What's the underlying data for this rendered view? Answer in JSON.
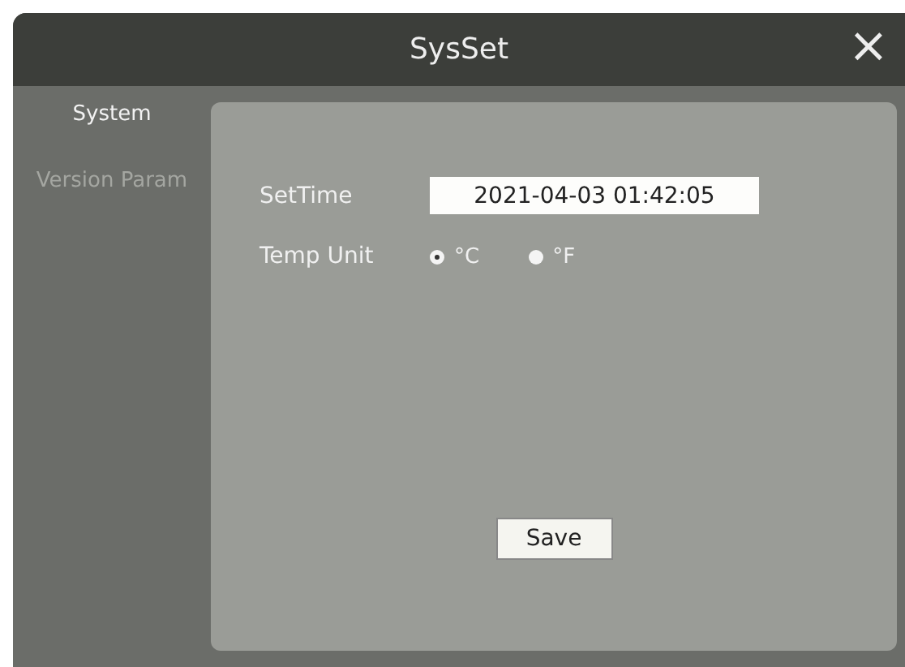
{
  "window": {
    "title": "SysSet",
    "close": "×"
  },
  "sidebar": {
    "items": [
      {
        "label": "System",
        "selected": true
      },
      {
        "label": "Version Param",
        "selected": false
      }
    ]
  },
  "form": {
    "set_time": {
      "label": "SetTime",
      "value": "2021-04-03 01:42:05"
    },
    "temp_unit": {
      "label": "Temp Unit",
      "options": [
        {
          "label": "°C",
          "selected": true
        },
        {
          "label": "°F",
          "selected": false
        }
      ]
    }
  },
  "buttons": [
    "Save"
  ]
}
